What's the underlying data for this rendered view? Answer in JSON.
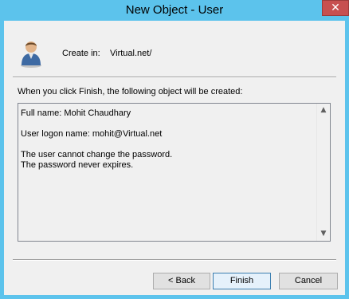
{
  "window": {
    "title": "New Object - User",
    "close_glyph": "✕"
  },
  "header": {
    "icon": "user-icon",
    "create_in_label": "Create in:",
    "create_in_value": "Virtual.net/"
  },
  "instruction": "When you click Finish, the following object will be created:",
  "summary": {
    "full_name": "Full name: Mohit Chaudhary",
    "logon_name": "User logon name: mohit@Virtual.net",
    "password_note_1": "The user cannot change the password.",
    "password_note_2": "The password never expires."
  },
  "buttons": {
    "back": "< Back",
    "finish": "Finish",
    "cancel": "Cancel"
  },
  "colors": {
    "titlebar": "#5cc3ec",
    "close": "#c75050",
    "default_button_border": "#3c7fb1"
  }
}
